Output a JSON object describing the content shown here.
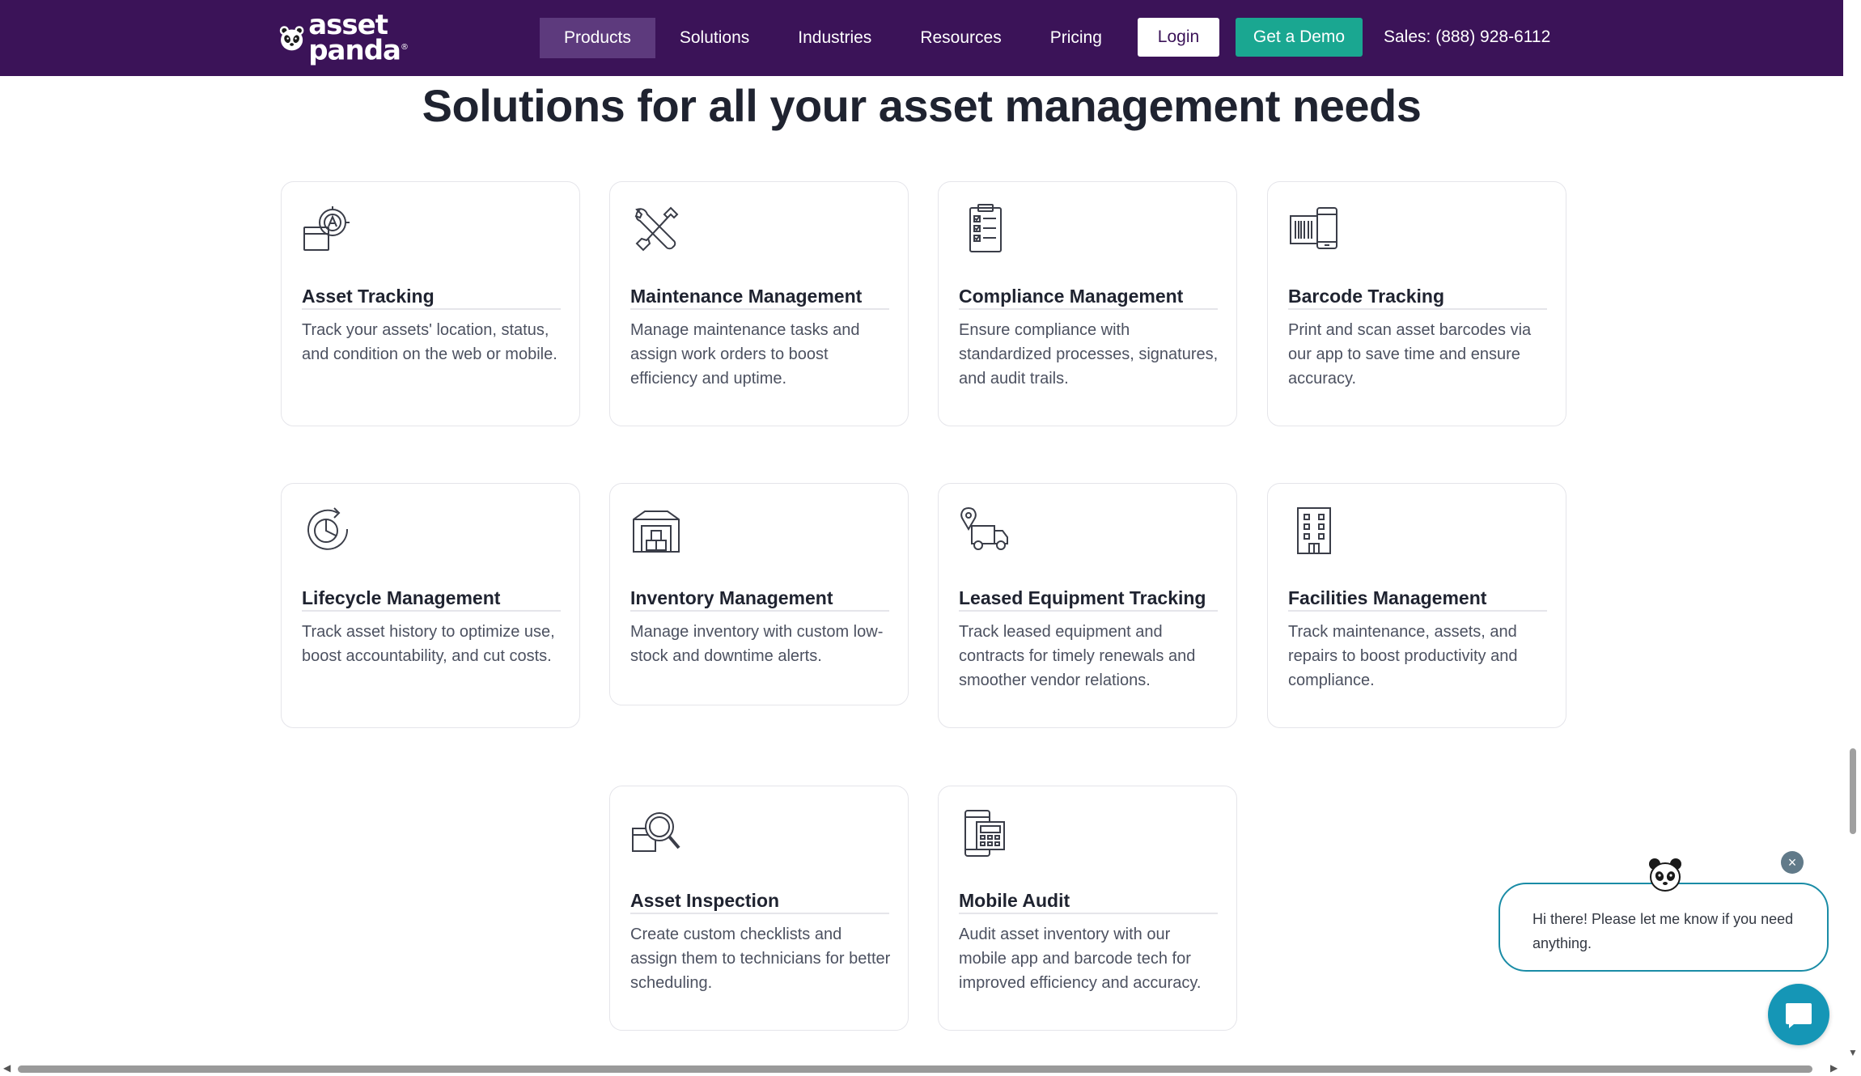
{
  "brand": {
    "line1": "asset",
    "line2": "panda",
    "reg": "®"
  },
  "nav": {
    "items": [
      {
        "label": "Products"
      },
      {
        "label": "Solutions"
      },
      {
        "label": "Industries"
      },
      {
        "label": "Resources"
      },
      {
        "label": "Pricing"
      }
    ],
    "active": "Products",
    "login_label": "Login",
    "demo_label": "Get a Demo",
    "sales_label": "Sales: (888) 928-6112"
  },
  "main": {
    "heading": "Solutions for all your asset management needs",
    "cards": [
      {
        "icon": "asset-tracking-icon",
        "title": "Asset Tracking",
        "description": "Track your assets' location, status, and condition on the web or mobile."
      },
      {
        "icon": "maintenance-tools-icon",
        "title": "Maintenance Management",
        "description": "Manage maintenance tasks and assign work orders to boost efficiency and uptime."
      },
      {
        "icon": "checklist-icon",
        "title": "Compliance Management",
        "description": "Ensure compliance with standardized processes, signatures, and audit trails."
      },
      {
        "icon": "barcode-phone-icon",
        "title": "Barcode Tracking",
        "description": "Print and scan asset barcodes via our app to save time and ensure accuracy."
      },
      {
        "icon": "lifecycle-chart-icon",
        "title": "Lifecycle Management",
        "description": "Track asset history to optimize use, boost accountability, and cut costs."
      },
      {
        "icon": "warehouse-icon",
        "title": "Inventory Management",
        "description": "Manage inventory with custom low-stock and downtime alerts."
      },
      {
        "icon": "truck-location-icon",
        "title": "Leased Equipment Tracking",
        "description": "Track leased equipment and contracts for timely renewals and smoother vendor relations."
      },
      {
        "icon": "building-icon",
        "title": "Facilities Management",
        "description": "Track maintenance, assets, and repairs to boost productivity and compliance."
      },
      {
        "icon": "inspection-magnifier-icon",
        "title": "Asset Inspection",
        "description": "Create custom checklists and assign them to technicians for better scheduling."
      },
      {
        "icon": "mobile-audit-icon",
        "title": "Mobile Audit",
        "description": "Audit asset inventory with our mobile app and barcode tech for improved efficiency and accuracy."
      }
    ]
  },
  "chat": {
    "message": "Hi there! Please let me know if you need anything.",
    "close_label": "×"
  },
  "colors": {
    "nav_bg": "#3b1358",
    "nav_active": "#5d3a7d",
    "demo_button": "#1aa791",
    "chat_accent": "#1596b6"
  }
}
